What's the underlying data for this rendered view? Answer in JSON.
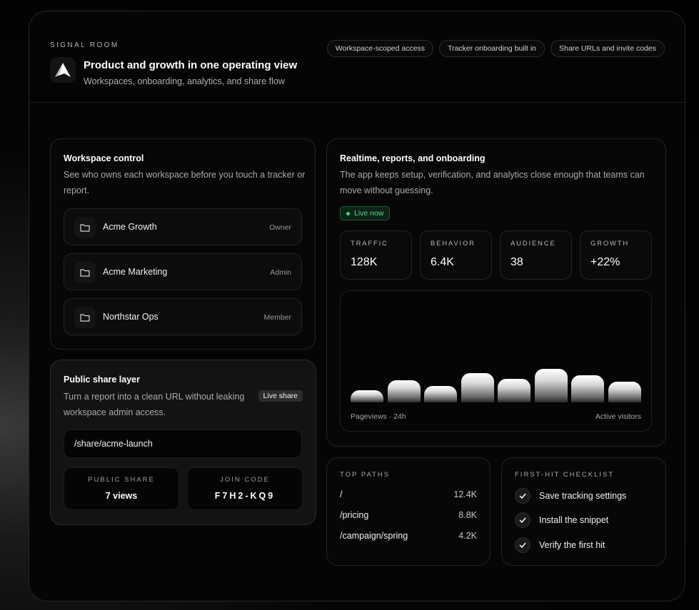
{
  "header": {
    "eyebrow": "SIGNAL ROOM",
    "title": "Product and growth in one operating view",
    "subtitle": "Workspaces, onboarding, analytics, and share flow",
    "pills": [
      "Workspace-scoped access",
      "Tracker onboarding built in",
      "Share URLs and invite codes"
    ]
  },
  "workspace": {
    "title": "Workspace control",
    "description": "See who owns each workspace before you touch a tracker or report.",
    "items": [
      {
        "name": "Acme Growth",
        "role": "Owner"
      },
      {
        "name": "Acme Marketing",
        "role": "Admin"
      },
      {
        "name": "Northstar Ops",
        "role": "Member"
      }
    ]
  },
  "share": {
    "title": "Public share layer",
    "description": "Turn a report into a clean URL without leaking workspace admin access.",
    "badge": "Live share",
    "path": "/share/acme-launch",
    "public_label": "PUBLIC SHARE",
    "public_value": "7 views",
    "join_label": "JOIN CODE",
    "join_value": "F7H2-KQ9"
  },
  "realtime": {
    "title": "Realtime, reports, and onboarding",
    "description": "The app keeps setup, verification, and analytics close enough that teams can move without guessing.",
    "live_badge": "Live now",
    "metrics": [
      {
        "label": "TRAFFIC",
        "value": "128K"
      },
      {
        "label": "BEHAVIOR",
        "value": "6.4K"
      },
      {
        "label": "AUDIENCE",
        "value": "38"
      },
      {
        "label": "GROWTH",
        "value": "+22%"
      }
    ],
    "chart_left_label": "Pageviews · 24h",
    "chart_right_label": "Active visitors"
  },
  "chart_data": {
    "type": "bar",
    "values": [
      17,
      31,
      23,
      41,
      33,
      47,
      38,
      29
    ]
  },
  "top_paths": {
    "label": "TOP PATHS",
    "rows": [
      {
        "path": "/",
        "value": "12.4K"
      },
      {
        "path": "/pricing",
        "value": "8.8K"
      },
      {
        "path": "/campaign/spring",
        "value": "4.2K"
      }
    ]
  },
  "checklist": {
    "label": "FIRST-HIT CHECKLIST",
    "items": [
      "Save tracking settings",
      "Install the snippet",
      "Verify the first hit"
    ]
  }
}
